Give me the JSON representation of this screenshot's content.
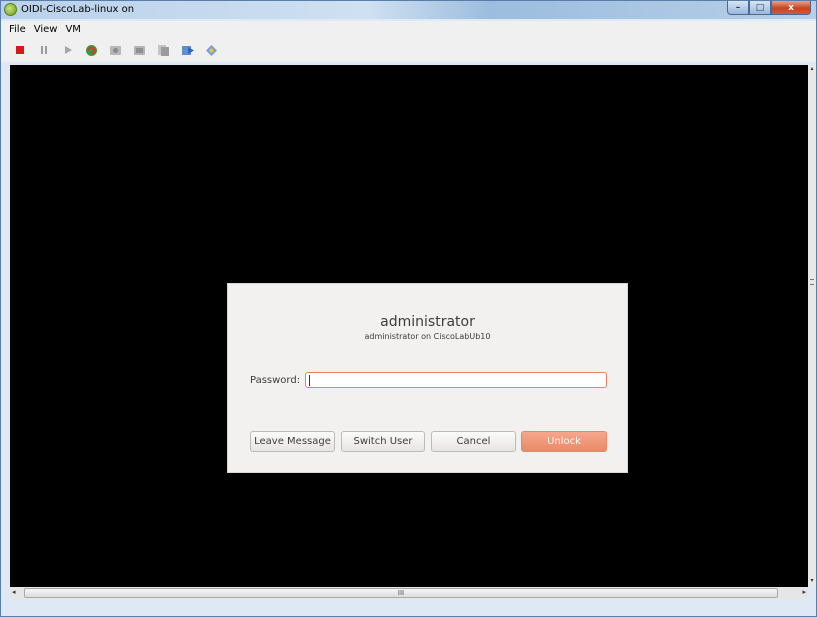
{
  "window": {
    "title": "OIDI-CiscoLab-linux on",
    "min_glyph": "–",
    "max_glyph": "□",
    "close_glyph": "x"
  },
  "menubar": {
    "items": [
      {
        "label": "File"
      },
      {
        "label": "View"
      },
      {
        "label": "VM"
      }
    ]
  },
  "toolbar": {
    "buttons": [
      {
        "icon": "stop-icon"
      },
      {
        "icon": "pause-icon"
      },
      {
        "icon": "play-icon"
      },
      {
        "icon": "reset-icon"
      },
      {
        "icon": "snapshot-icon"
      },
      {
        "icon": "revert-icon"
      },
      {
        "icon": "manage-snapshots-icon"
      },
      {
        "icon": "send-keys-icon"
      },
      {
        "icon": "settings-icon"
      }
    ]
  },
  "lock_dialog": {
    "user_name": "administrator",
    "user_subtitle": "administrator on CiscoLabUb10",
    "password_label": "Password:",
    "password_value": "",
    "buttons": {
      "leave_message": "Leave Message",
      "switch_user": "Switch User",
      "cancel": "Cancel",
      "unlock": "Unlock"
    }
  },
  "scrollbars": {
    "h_grip": "III",
    "left_arrow": "◂",
    "right_arrow": "▸",
    "up_arrow": "▴",
    "down_arrow": "▾"
  },
  "colors": {
    "accent_orange": "#ea8a68",
    "display_background": "#000000"
  }
}
